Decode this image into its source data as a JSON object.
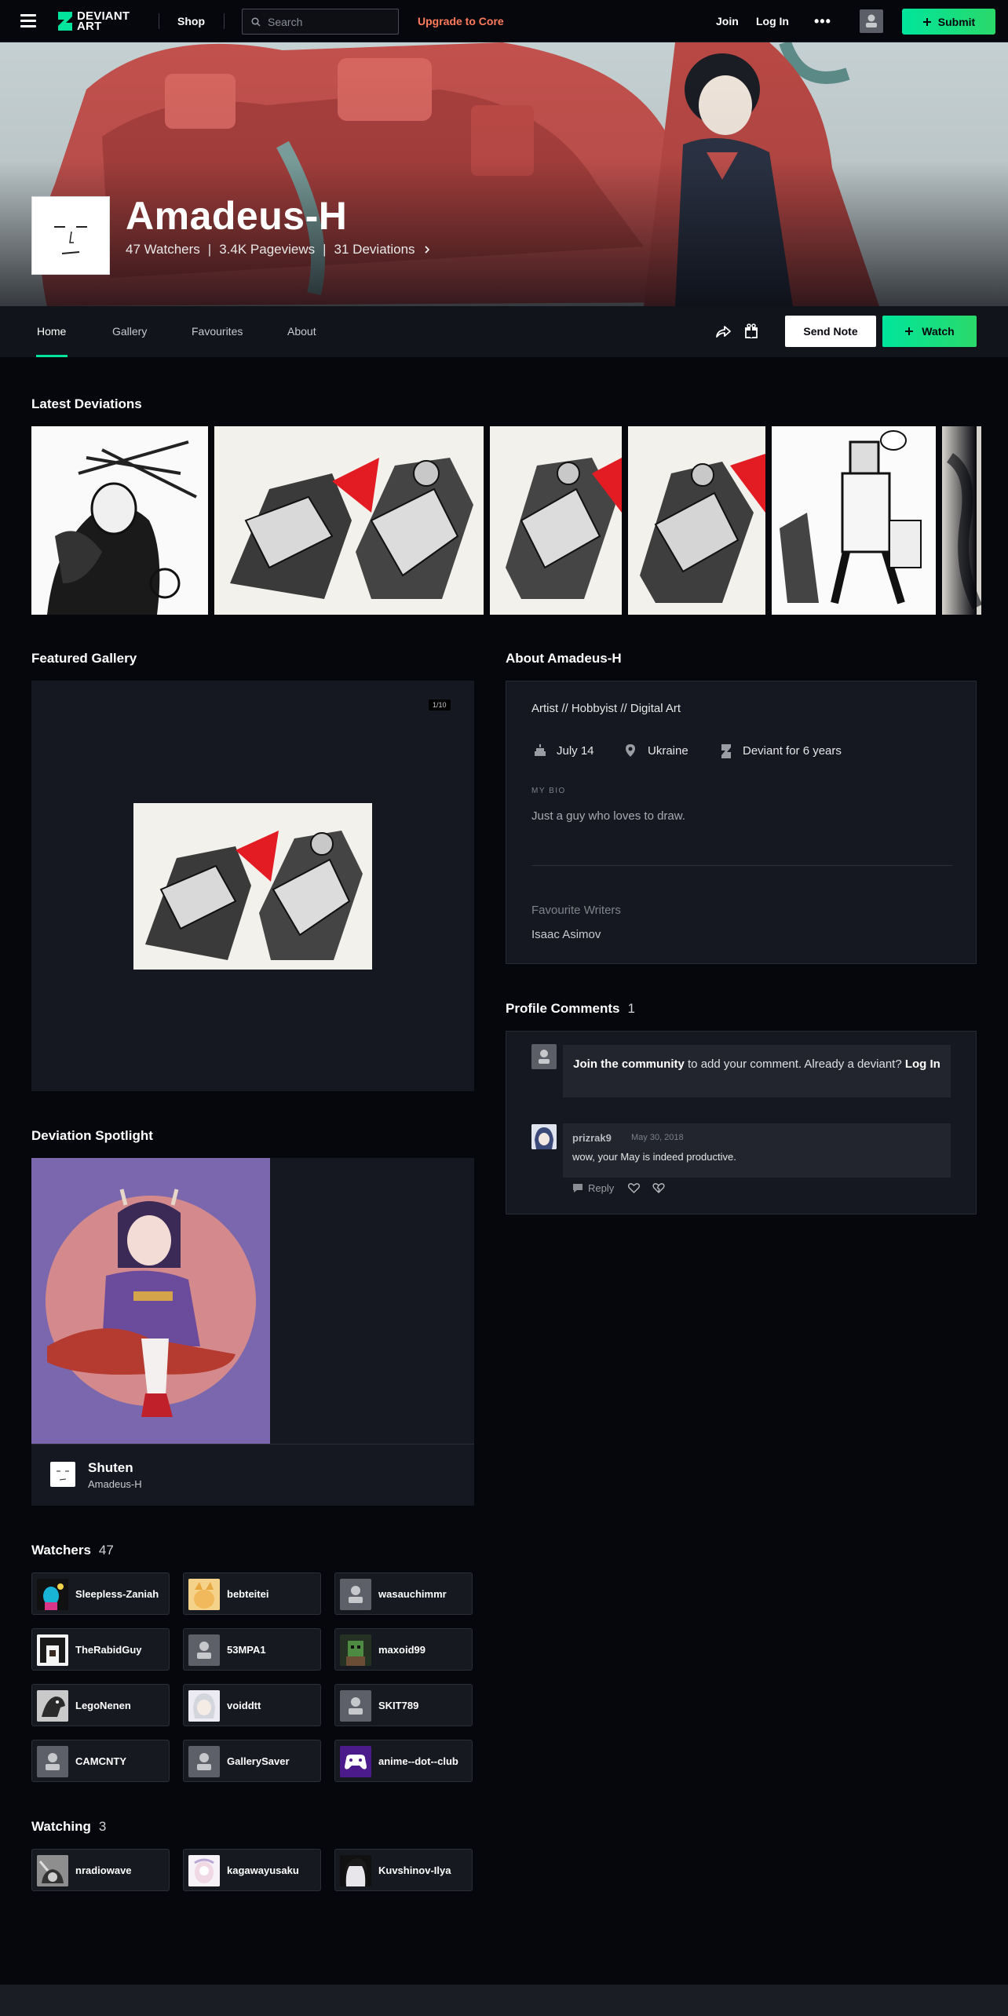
{
  "topbar": {
    "logo_text_line1": "DEVIANT",
    "logo_text_line2": "ART",
    "shop": "Shop",
    "search_placeholder": "Search",
    "upgrade": "Upgrade to Core",
    "join": "Join",
    "login": "Log In",
    "more": "•••",
    "submit": "Submit"
  },
  "profile": {
    "name": "Amadeus-H",
    "watchers": "47 Watchers",
    "pageviews": "3.4K Pageviews",
    "deviations": "31 Deviations",
    "divider": "|"
  },
  "nav": {
    "tabs": [
      "Home",
      "Gallery",
      "Favourites",
      "About"
    ],
    "send_note": "Send Note",
    "watch": "Watch"
  },
  "latest": {
    "title": "Latest Deviations"
  },
  "featured": {
    "title": "Featured Gallery",
    "counter": "1/10"
  },
  "about": {
    "title": "About Amadeus-H",
    "tagline": "Artist  //  Hobbyist  //  Digital Art",
    "birthday": "July 14",
    "location": "Ukraine",
    "deviant_for": "Deviant for 6 years",
    "bio_label": "MY BIO",
    "bio": "Just a guy who loves to draw.",
    "fav_label": "Favourite Writers",
    "fav_value": "Isaac Asimov"
  },
  "comments": {
    "title": "Profile Comments",
    "count": "1",
    "join_bold": "Join the community",
    "join_rest": " to add your comment. Already a deviant? ",
    "join_login": "Log In",
    "comment": {
      "user": "prizrak9",
      "date": "May 30, 2018",
      "text": "wow, your May is indeed productive.",
      "reply": "Reply"
    }
  },
  "spotlight": {
    "title": "Deviation Spotlight",
    "art_title": "Shuten",
    "artist": "Amadeus-H"
  },
  "watchers": {
    "title": "Watchers",
    "count": "47",
    "items": [
      "Sleepless-Zaniah",
      "bebteitei",
      "wasauchimmr",
      "TheRabidGuy",
      "53MPA1",
      "maxoid99",
      "LegoNenen",
      "voiddtt",
      "SKIT789",
      "CAMCNTY",
      "GallerySaver",
      "anime--dot--club"
    ]
  },
  "watching": {
    "title": "Watching",
    "count": "3",
    "items": [
      "nradiowave",
      "kagawayusaku",
      "Kuvshinov-Ilya"
    ]
  },
  "colors": {
    "accent": "#00e59b",
    "upgrade": "#ff7b5c",
    "background": "#06070d",
    "panel": "#151821"
  }
}
